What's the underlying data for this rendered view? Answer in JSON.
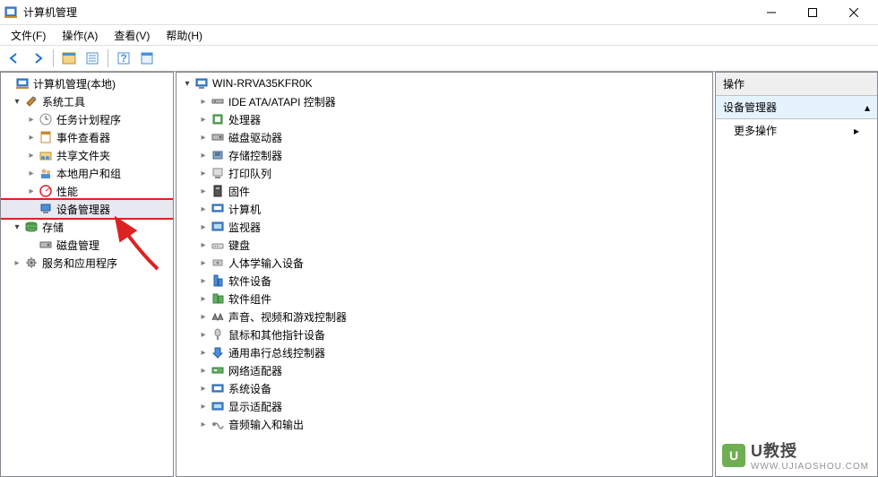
{
  "window": {
    "title": "计算机管理"
  },
  "menu": {
    "file": "文件(F)",
    "action": "操作(A)",
    "view": "查看(V)",
    "help": "帮助(H)"
  },
  "left_tree": {
    "root": "计算机管理(本地)",
    "system_tools": "系统工具",
    "task_scheduler": "任务计划程序",
    "event_viewer": "事件查看器",
    "shared_folders": "共享文件夹",
    "local_users": "本地用户和组",
    "performance": "性能",
    "device_manager": "设备管理器",
    "storage": "存储",
    "disk_management": "磁盘管理",
    "services_apps": "服务和应用程序"
  },
  "mid_tree": {
    "computer": "WIN-RRVA35KFR0K",
    "items": [
      "IDE ATA/ATAPI 控制器",
      "处理器",
      "磁盘驱动器",
      "存储控制器",
      "打印队列",
      "固件",
      "计算机",
      "监视器",
      "键盘",
      "人体学输入设备",
      "软件设备",
      "软件组件",
      "声音、视频和游戏控制器",
      "鼠标和其他指针设备",
      "通用串行总线控制器",
      "网络适配器",
      "系统设备",
      "显示适配器",
      "音频输入和输出"
    ]
  },
  "actions": {
    "header": "操作",
    "subject": "设备管理器",
    "more": "更多操作"
  },
  "watermark": {
    "brand": "U教授",
    "url": "WWW.UJIAOSHOU.COM"
  }
}
